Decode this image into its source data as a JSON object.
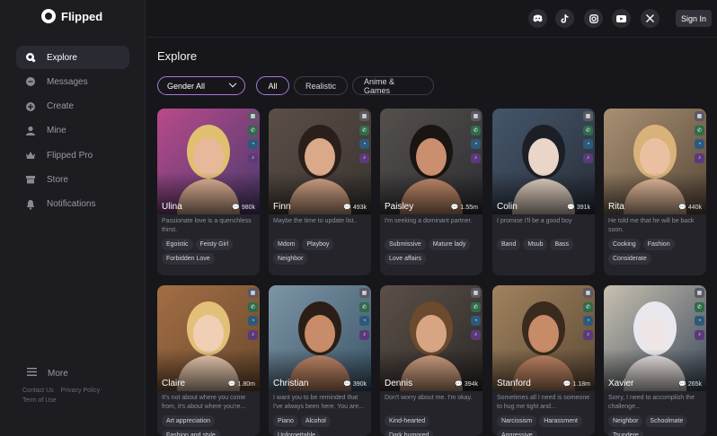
{
  "app": {
    "name": "Flipped"
  },
  "sidebar": {
    "items": [
      {
        "label": "Explore",
        "icon": "explore-icon",
        "active": true
      },
      {
        "label": "Messages",
        "icon": "chat-icon"
      },
      {
        "label": "Create",
        "icon": "plus-icon"
      },
      {
        "label": "Mine",
        "icon": "user-icon"
      },
      {
        "label": "Flipped Pro",
        "icon": "crown-icon"
      },
      {
        "label": "Store",
        "icon": "store-icon"
      },
      {
        "label": "Notifications",
        "icon": "bell-icon"
      }
    ],
    "more": "More",
    "footer": {
      "contact": "Contact Us",
      "privacy": "Privacy Policy",
      "terms": "Term of Use"
    }
  },
  "header": {
    "social": [
      "discord-icon",
      "tiktok-icon",
      "instagram-icon",
      "youtube-icon",
      "x-icon"
    ],
    "signin": "Sign In"
  },
  "page": {
    "title": "Explore",
    "gender_select": "Gender All",
    "filters": [
      "All",
      "Realistic",
      "Anime & Games"
    ],
    "active_filter": "All"
  },
  "colors": {
    "accent": "#a57ad6",
    "background": "#17171b",
    "card": "#24242a"
  },
  "cards": [
    {
      "name": "Ulina",
      "count": "980k",
      "desc": "Passionate love is a quenchless thirst.",
      "tags": [
        "Egoistic",
        "Feisty Girl",
        "Forbidden Love"
      ]
    },
    {
      "name": "Finn",
      "count": "493k",
      "desc": "Maybe the time to update list..",
      "tags": [
        "Mdom",
        "Playboy",
        "Neighbor"
      ]
    },
    {
      "name": "Paisley",
      "count": "1.55m",
      "desc": "I'm seeking a dominant partner.",
      "tags": [
        "Submissive",
        "Mature lady",
        "Love affairs"
      ]
    },
    {
      "name": "Colin",
      "count": "391k",
      "desc": "I promise I'll be a good boy",
      "tags": [
        "Band",
        "Msub",
        "Bass"
      ]
    },
    {
      "name": "Rita",
      "count": "440k",
      "desc": "He told me that he will be back soon.",
      "tags": [
        "Cooking",
        "Fashion",
        "Considerate"
      ]
    },
    {
      "name": "Claire",
      "count": "1.80m",
      "desc": "It's not about where you come from, it's about where you're...",
      "tags": [
        "Art appreciation",
        "Fashion and style"
      ]
    },
    {
      "name": "Christian",
      "count": "390k",
      "desc": "I want you to be reminded that I've always been here. You are...",
      "tags": [
        "Piano",
        "Alcohol",
        "Unforgettable"
      ]
    },
    {
      "name": "Dennis",
      "count": "394k",
      "desc": "Don't worry about me. I'm okay.",
      "tags": [
        "Kind-hearted",
        "Dark humored"
      ]
    },
    {
      "name": "Stanford",
      "count": "1.18m",
      "desc": "Sometimes all I need is someone to hug me tight and...",
      "tags": [
        "Narcissism",
        "Harassment",
        "Aggressive"
      ]
    },
    {
      "name": "Xavier",
      "count": "265k",
      "desc": "Sorry, I need to accomplish the challenge...",
      "tags": [
        "Neighbor",
        "Schoolmate",
        "Tsundere"
      ]
    }
  ]
}
